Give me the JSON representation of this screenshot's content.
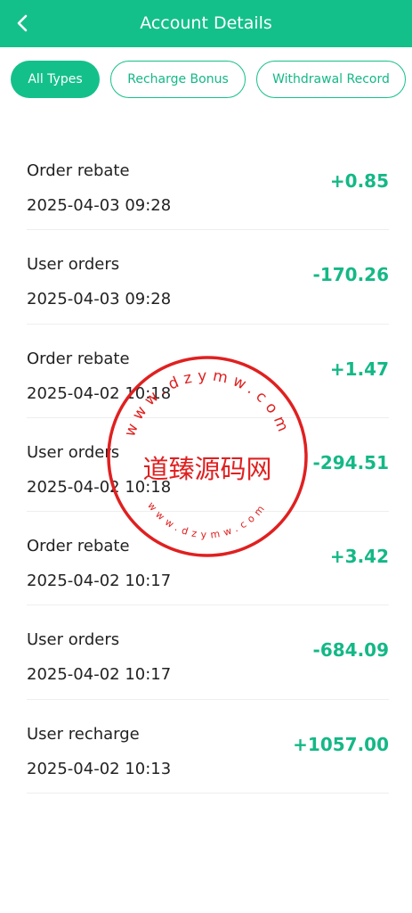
{
  "header": {
    "title": "Account Details",
    "back_icon": "chevron-left-icon"
  },
  "tabs": [
    {
      "label": "All Types",
      "active": true
    },
    {
      "label": "Recharge Bonus",
      "active": false
    },
    {
      "label": "Withdrawal Record",
      "active": false
    }
  ],
  "transactions": [
    {
      "title": "Order rebate",
      "date": "2025-04-03 09:28",
      "amount": "+0.85"
    },
    {
      "title": "User orders",
      "date": "2025-04-03 09:28",
      "amount": "-170.26"
    },
    {
      "title": "Order rebate",
      "date": "2025-04-02 10:18",
      "amount": "+1.47"
    },
    {
      "title": "User orders",
      "date": "2025-04-02 10:18",
      "amount": "-294.51"
    },
    {
      "title": "Order rebate",
      "date": "2025-04-02 10:17",
      "amount": "+3.42"
    },
    {
      "title": "User orders",
      "date": "2025-04-02 10:17",
      "amount": "-684.09"
    },
    {
      "title": "User recharge",
      "date": "2025-04-02 10:13",
      "amount": "+1057.00"
    }
  ],
  "watermark": {
    "text": "道臻源码网",
    "url_text": "www.dzymw.com"
  },
  "colors": {
    "accent": "#14c08a",
    "amount": "#14b886",
    "watermark": "#e02020"
  }
}
